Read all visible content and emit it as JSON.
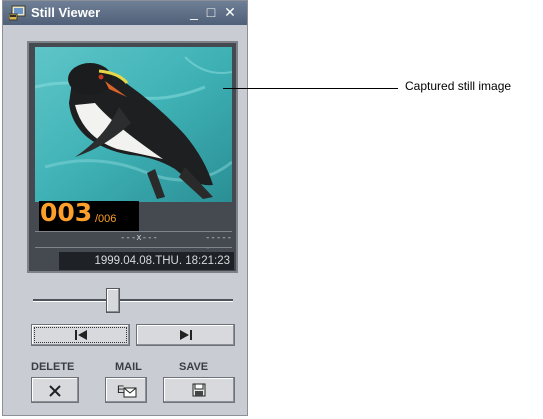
{
  "window": {
    "title": "Still Viewer",
    "controls": [
      "minimize-icon",
      "maximize-icon",
      "close-icon"
    ]
  },
  "viewer": {
    "current_frame": "003",
    "total_frames": "/006",
    "marker_center": "---x---",
    "marker_right": "------",
    "timestamp": "1999.04.08.THU.  18:21:23"
  },
  "slider": {
    "position": 0.4
  },
  "navigation": {
    "prev_icon": "skip-back-icon",
    "next_icon": "skip-forward-icon"
  },
  "actions": {
    "delete_label": "DELETE",
    "mail_label": "MAIL",
    "save_label": "SAVE"
  },
  "annotation": {
    "callout": "Captured still image"
  },
  "colors": {
    "titlebar": "#5b6a82",
    "window_bg": "#c9ccd3",
    "counter_text": "#ff9f2b",
    "viewer_bg": "#454a50"
  }
}
